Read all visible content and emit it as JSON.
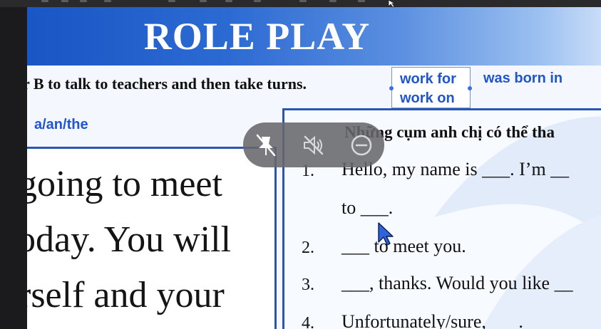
{
  "banner": {
    "title": "ROLE PLAY"
  },
  "instruction": "r B to talk to teachers and then take turns.",
  "chips": [
    "work for",
    "work on",
    "was born in",
    "a/an/the"
  ],
  "left_panel": {
    "lines": [
      "going to meet",
      "oday. You will",
      "rself and your"
    ]
  },
  "right_panel": {
    "heading": "Những cụm anh chị có thể tha",
    "questions": [
      {
        "num": "1.",
        "text": "Hello, my name is ___. I’m __"
      },
      {
        "num": "",
        "text": "to ___."
      },
      {
        "num": "2.",
        "text": "___ to meet you."
      },
      {
        "num": "3.",
        "text": "___, thanks. Would you like __"
      },
      {
        "num": "4.",
        "text": "Unfortunately/sure, ___."
      }
    ]
  },
  "overlay": {
    "icons": [
      "unpin-icon",
      "mute-icon",
      "minus-circle-icon"
    ]
  },
  "colors": {
    "banner_blue": "#1a56c4",
    "chip_blue": "#1f55cf",
    "panel_border": "#2a55b5",
    "overlay_gray": "#68686c"
  }
}
